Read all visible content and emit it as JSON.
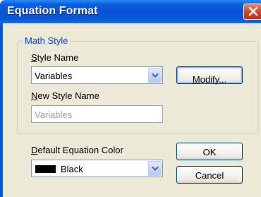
{
  "window": {
    "title": "Equation Format"
  },
  "math_style": {
    "group_label": "Math Style",
    "style_name_label_accel": "S",
    "style_name_label_rest": "tyle Name",
    "style_name_value": "Variables",
    "new_style_label_accel": "N",
    "new_style_label_rest": "ew Style Name",
    "new_style_value": "Variables"
  },
  "buttons": {
    "modify_accel": "M",
    "modify_rest": "odify...",
    "ok": "OK",
    "cancel": "Cancel"
  },
  "color": {
    "label_accel": "D",
    "label_rest": "efault Equation Color",
    "value": "Black",
    "swatch_color": "#000000"
  },
  "icons": {
    "close": "close-icon",
    "dropdown": "chevron-down-icon"
  }
}
